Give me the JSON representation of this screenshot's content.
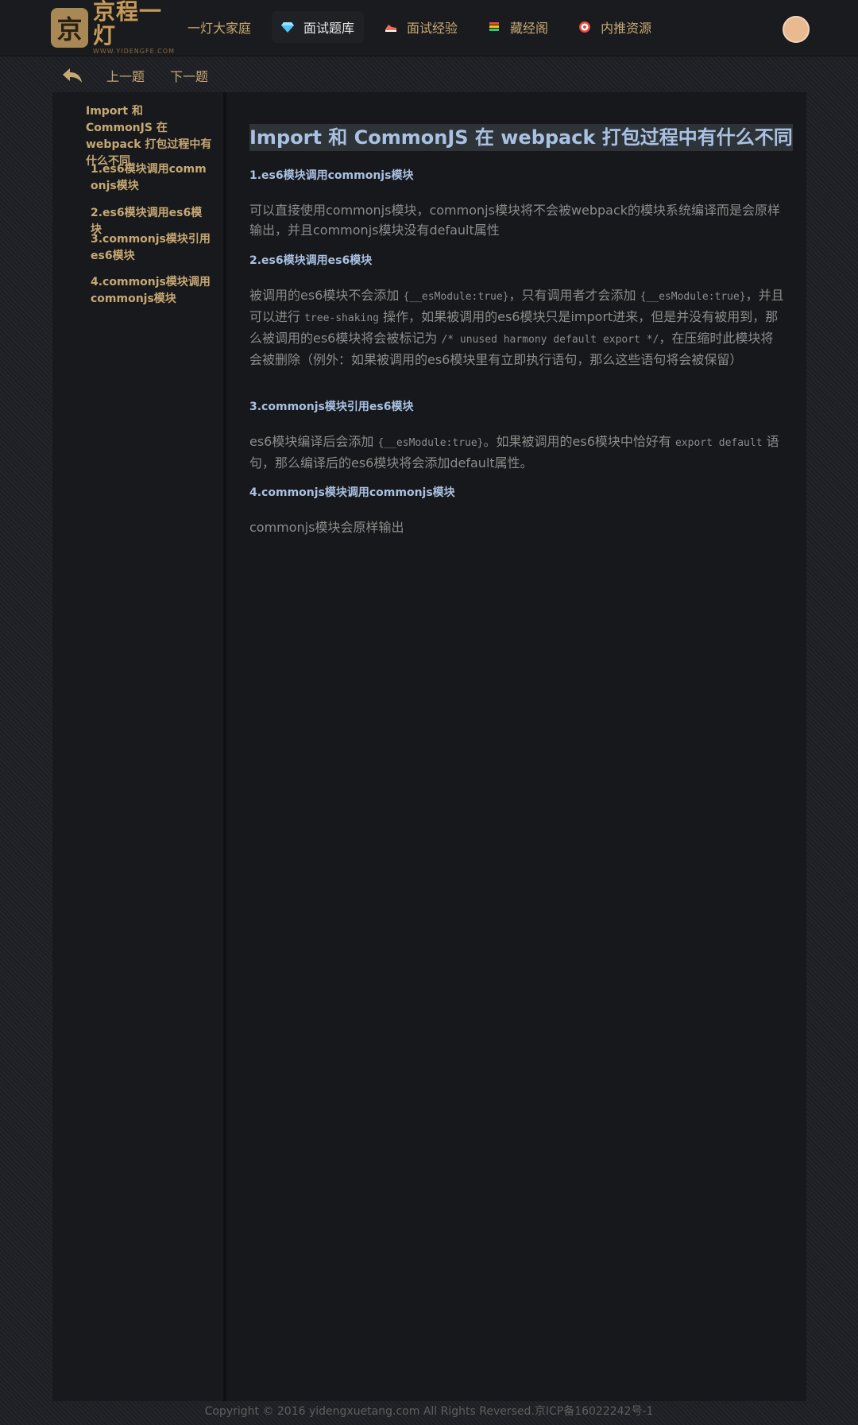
{
  "header": {
    "logo_title": "京程一灯",
    "logo_sub": "WWW.YIDENGFE.COM",
    "nav": [
      {
        "label": "一灯大家庭",
        "icon": "none"
      },
      {
        "label": "面试题库",
        "icon": "diamond-icon"
      },
      {
        "label": "面试经验",
        "icon": "shoe-icon"
      },
      {
        "label": "藏经阁",
        "icon": "books-icon"
      },
      {
        "label": "内推资源",
        "icon": "target-icon"
      }
    ]
  },
  "toolbar": {
    "prev": "上一题",
    "next": "下一题"
  },
  "sidebar": {
    "title": "Import 和 CommonJS 在 webpack 打包过程中有什么不同",
    "items": [
      "1.es6模块调用commonjs模块",
      "2.es6模块调用es6模块",
      "3.commonjs模块引用es6模块",
      "4.commonjs模块调用commonjs模块"
    ]
  },
  "article": {
    "title": "Import 和 CommonJS 在 webpack 打包过程中有什么不同",
    "sections": [
      {
        "heading": "1.es6模块调用commonjs模块",
        "text": "可以直接使用commonjs模块，commonjs模块将不会被webpack的模块系统编译而是会原样输出，并且commonjs模块没有default属性"
      },
      {
        "heading": "2.es6模块调用es6模块",
        "text_a": "被调用的es6模块不会添加 ",
        "code_a": "{__esModule:true}",
        "text_b": "，只有调用者才会添加 ",
        "code_b": "{__esModule:true}",
        "text_c": "，并且可以进行 ",
        "code_c": "tree-shaking",
        "text_d": " 操作，如果被调用的es6模块只是import进来，但是并没有被用到，那么被调用的es6模块将会被标记为 ",
        "code_d": "/* unused harmony default export */",
        "text_e": "，在压缩时此模块将会被删除（例外：如果被调用的es6模块里有立即执行语句，那么这些语句将会被保留）"
      },
      {
        "heading": "3.commonjs模块引用es6模块",
        "text_a": "es6模块编译后会添加 ",
        "code_a": "{__esModule:true}",
        "text_b": "。如果被调用的es6模块中恰好有 ",
        "code_b": "export default",
        "text_c": " 语句，那么编译后的es6模块将会添加default属性。"
      },
      {
        "heading": "4.commonjs模块调用commonjs模块",
        "text": "commonjs模块会原样输出"
      }
    ]
  },
  "footer": {
    "text": "Copyright © 2016 yidengxuetang.com All Rights Reversed.京ICP备16022242号-1"
  },
  "colors": {
    "accent": "#c7a874",
    "heading": "#a9c1e2",
    "body_text": "#8c8c8c"
  }
}
